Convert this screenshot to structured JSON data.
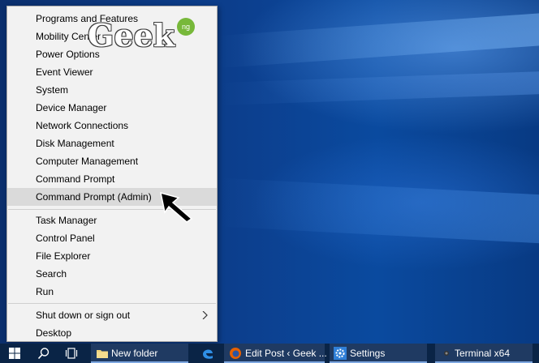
{
  "menu": {
    "items": [
      {
        "label": "Programs and Features"
      },
      {
        "label": "Mobility Center"
      },
      {
        "label": "Power Options"
      },
      {
        "label": "Event Viewer"
      },
      {
        "label": "System"
      },
      {
        "label": "Device Manager"
      },
      {
        "label": "Network Connections"
      },
      {
        "label": "Disk Management"
      },
      {
        "label": "Computer Management"
      },
      {
        "label": "Command Prompt"
      },
      {
        "label": "Command Prompt (Admin)"
      },
      {
        "label": "Task Manager"
      },
      {
        "label": "Control Panel"
      },
      {
        "label": "File Explorer"
      },
      {
        "label": "Search"
      },
      {
        "label": "Run"
      },
      {
        "label": "Shut down or sign out"
      },
      {
        "label": "Desktop"
      }
    ],
    "highlighted": "Command Prompt (Admin)"
  },
  "watermark": {
    "text": "Geek",
    "badge": "ng"
  },
  "taskbar": {
    "buttons": [
      {
        "label": "New folder",
        "icon": "folder-icon"
      },
      {
        "label": "Edit Post ‹ Geek ...",
        "icon": "firefox-icon"
      },
      {
        "label": "Settings",
        "icon": "gear-icon"
      },
      {
        "label": "Terminal x64",
        "icon": "terminal-icon"
      }
    ]
  },
  "colors": {
    "menu_bg": "#f2f2f2",
    "highlight_bg": "#dadada",
    "taskbar_bg": "#0a2446",
    "taskbar_active": "#1f3a62",
    "accent": "#7da7e0"
  }
}
